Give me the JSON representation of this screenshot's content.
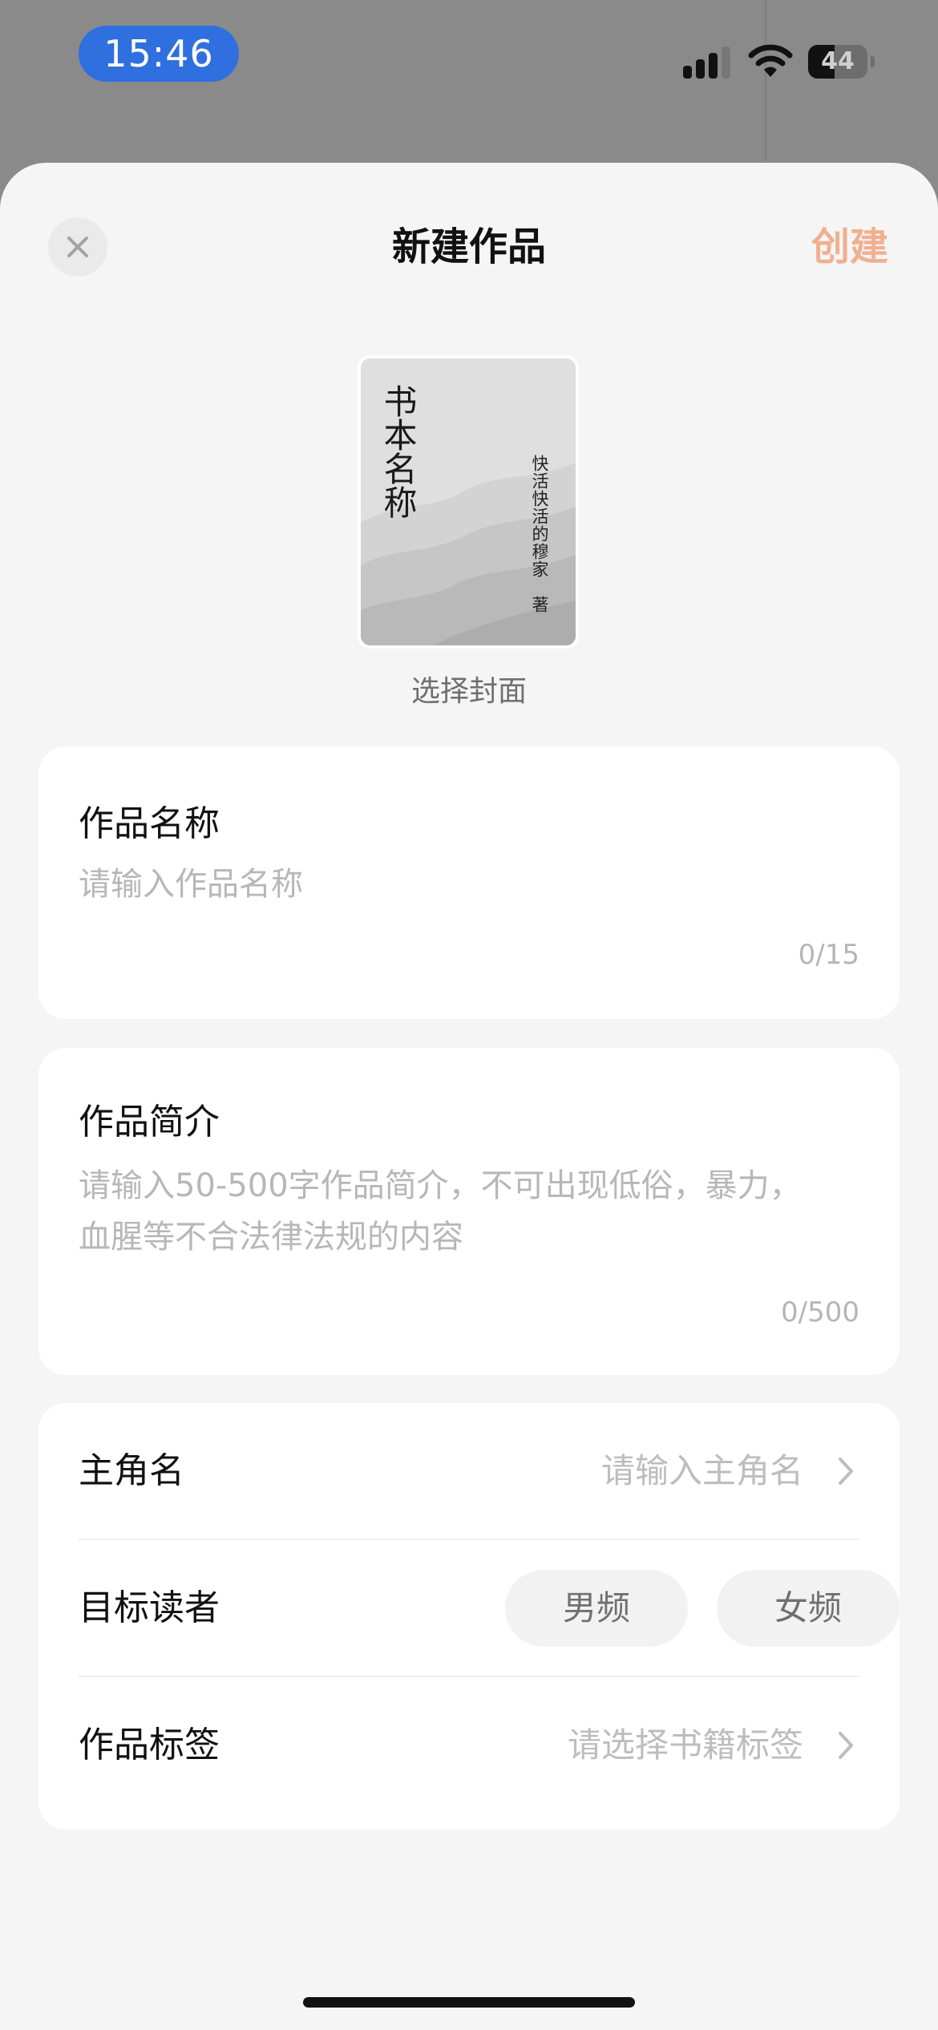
{
  "status_bar": {
    "time": "15:46",
    "battery_level": "44",
    "signal-icon": "signal-bars-icon",
    "wifi-icon": "wifi-icon"
  },
  "header": {
    "title": "新建作品",
    "create_label": "创建",
    "close_icon": "close-icon"
  },
  "cover": {
    "book_title": "书本名称",
    "author_line": "快活快活的穆家　著",
    "caption": "选择封面"
  },
  "name_field": {
    "label": "作品名称",
    "placeholder": "请输入作品名称",
    "counter": "0/15"
  },
  "intro_field": {
    "label": "作品简介",
    "placeholder": "请输入50-500字作品简介，不可出现低俗，暴力，血腥等不合法律法规的内容",
    "counter": "0/500"
  },
  "settings": {
    "protagonist": {
      "label": "主角名",
      "placeholder": "请输入主角名"
    },
    "target_reader": {
      "label": "目标读者",
      "options": [
        "男频",
        "女频"
      ]
    },
    "tags": {
      "label": "作品标签",
      "placeholder": "请选择书籍标签"
    }
  },
  "colors": {
    "accent": "#f0b090",
    "time_pill": "#2f6fdf",
    "sheet_bg": "#f5f5f5",
    "card_bg": "#ffffff"
  }
}
